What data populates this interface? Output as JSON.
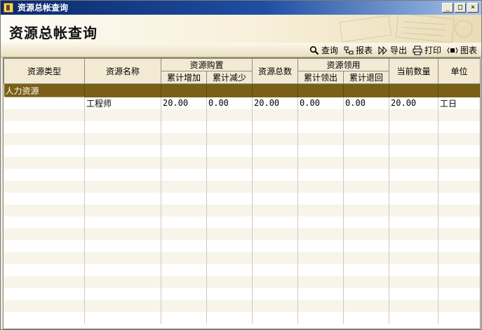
{
  "window": {
    "title": "资源总帐查询",
    "buttons": {
      "minimize": "_",
      "maximize": "□",
      "close": "×"
    }
  },
  "header": {
    "title": "资源总帐查询"
  },
  "toolbar": {
    "query": "查询",
    "report": "报表",
    "export": "导出",
    "print": "打印",
    "chart": "图表"
  },
  "table": {
    "headers": {
      "type": "资源类型",
      "name": "资源名称",
      "purchase": "资源购置",
      "cum_increase": "累计增加",
      "cum_decrease": "累计减少",
      "total": "资源总数",
      "usage": "资源领用",
      "cum_out": "累计领出",
      "cum_return": "累计退回",
      "current": "当前数量",
      "unit": "单位"
    },
    "group": {
      "label": "人力资源"
    },
    "rows": [
      {
        "type": "",
        "name": "工程师",
        "cum_increase": "20.00",
        "cum_decrease": "0.00",
        "total": "20.00",
        "cum_out": "0.00",
        "cum_return": "0.00",
        "current": "20.00",
        "unit": "工日"
      }
    ]
  }
}
